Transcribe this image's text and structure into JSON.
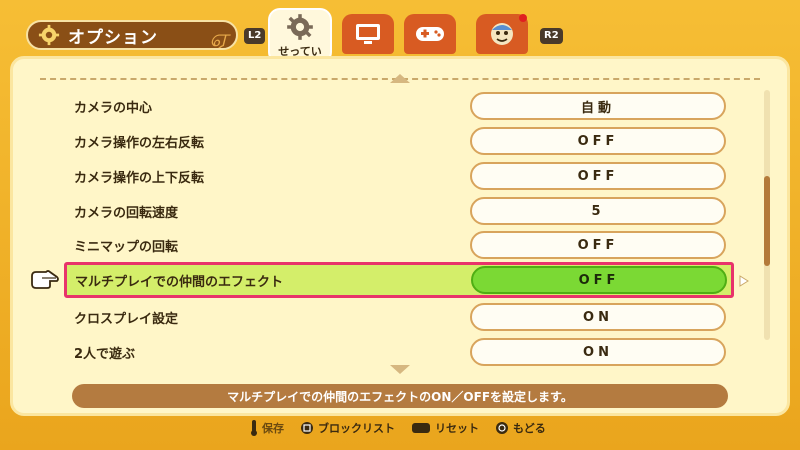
{
  "header": {
    "title": "オプション",
    "l2": "L2",
    "r2": "R2",
    "active_tab_label": "せってい"
  },
  "options": [
    {
      "label": "カメラの中心",
      "value": "自動"
    },
    {
      "label": "カメラ操作の左右反転",
      "value": "OFF"
    },
    {
      "label": "カメラ操作の上下反転",
      "value": "OFF"
    },
    {
      "label": "カメラの回転速度",
      "value": "5"
    },
    {
      "label": "ミニマップの回転",
      "value": "OFF"
    },
    {
      "label": "マルチプレイでの仲間のエフェクト",
      "value": "OFF",
      "selected": true
    },
    {
      "label": "クロスプレイ設定",
      "value": "ON"
    },
    {
      "label": "2人で遊ぶ",
      "value": "ON"
    }
  ],
  "description": "マルチプレイでの仲間のエフェクトのON／OFFを設定します。",
  "footer": {
    "save": "保存",
    "block_list": "ブロックリスト",
    "reset": "リセット",
    "back": "もどる"
  },
  "icons": {
    "title": "gear-icon",
    "tab_settings": "gear-icon",
    "tab_display": "monitor-icon",
    "tab_controller": "controller-icon",
    "tab_character": "character-icon",
    "pointer": "pointing-hand-icon"
  },
  "colors": {
    "selected_row": "#d4ee6a",
    "selected_border": "#e8336b",
    "selected_value": "#7bd934"
  }
}
